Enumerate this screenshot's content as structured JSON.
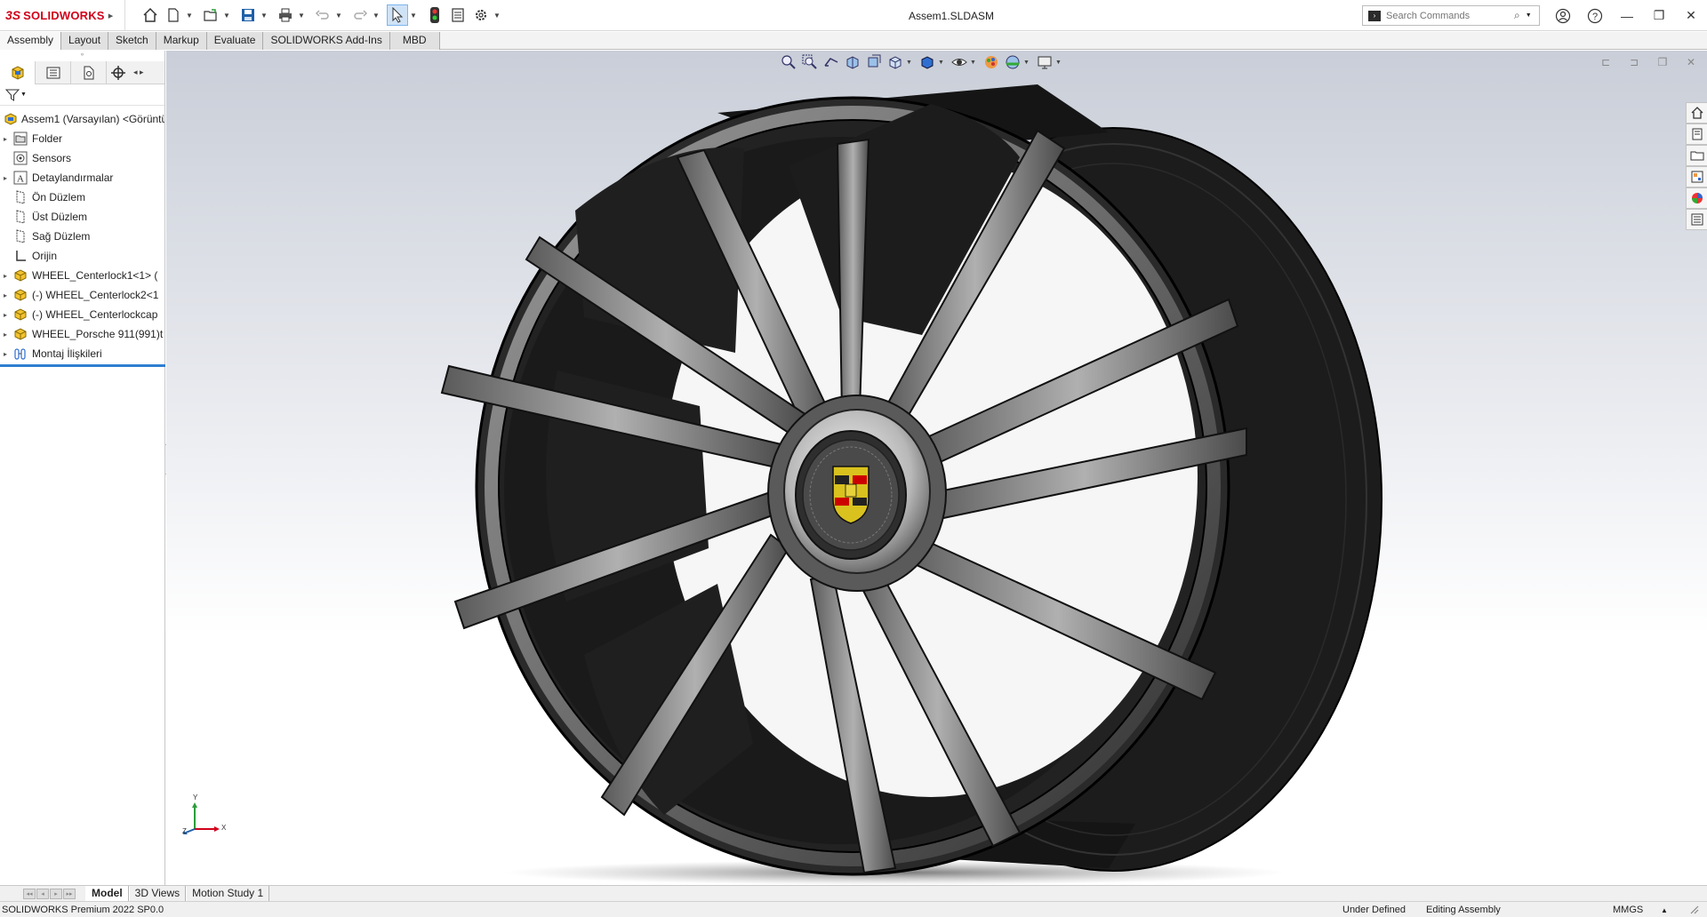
{
  "app": {
    "logo_ds": "3S",
    "logo_text": "SOLIDWORKS",
    "document_title": "Assem1.SLDASM"
  },
  "quick_access": [
    "home-icon",
    "new-icon",
    "open-icon",
    "save-icon",
    "print-icon",
    "undo-icon",
    "redo-icon",
    "select-icon",
    "rebuild-icon",
    "file-properties-icon",
    "options-icon"
  ],
  "search": {
    "placeholder": "Search Commands"
  },
  "command_tabs": [
    "Assembly",
    "Layout",
    "Sketch",
    "Markup",
    "Evaluate",
    "SOLIDWORKS Add-Ins",
    "MBD"
  ],
  "feature_tree": {
    "root": "Assem1 (Varsayılan) <Görüntü",
    "items": [
      {
        "label": "Folder",
        "icon": "folder-icon",
        "expandable": true
      },
      {
        "label": "Sensors",
        "icon": "sensors-icon",
        "expandable": false
      },
      {
        "label": "Detaylandırmalar",
        "icon": "annotations-icon",
        "expandable": true
      },
      {
        "label": "Ön Düzlem",
        "icon": "plane-icon",
        "expandable": false
      },
      {
        "label": "Üst Düzlem",
        "icon": "plane-icon",
        "expandable": false
      },
      {
        "label": "Sağ Düzlem",
        "icon": "plane-icon",
        "expandable": false
      },
      {
        "label": "Orijin",
        "icon": "origin-icon",
        "expandable": false
      },
      {
        "label": "WHEEL_Centerlock1<1> (",
        "icon": "part-icon",
        "expandable": true
      },
      {
        "label": "(-) WHEEL_Centerlock2<1",
        "icon": "part-icon",
        "expandable": true
      },
      {
        "label": "(-) WHEEL_Centerlockcap",
        "icon": "part-icon",
        "expandable": true
      },
      {
        "label": "WHEEL_Porsche 911(991)t",
        "icon": "part-icon",
        "expandable": true
      },
      {
        "label": "Montaj İlişkileri",
        "icon": "mates-icon",
        "expandable": true
      }
    ]
  },
  "model_tabs": [
    "Model",
    "3D Views",
    "Motion Study 1"
  ],
  "triad": {
    "x": "X",
    "y": "Y",
    "z": "Z"
  },
  "status": {
    "product": "SOLIDWORKS Premium 2022 SP0.0",
    "definition": "Under Defined",
    "mode": "Editing Assembly",
    "units": "MMGS",
    "units_arrow": "▲"
  },
  "colors": {
    "brand_red": "#d0021b",
    "selection_blue": "#2f7fd0",
    "wheel_dark": "#1e1e1e",
    "wheel_metal": "#8a8a8a"
  }
}
